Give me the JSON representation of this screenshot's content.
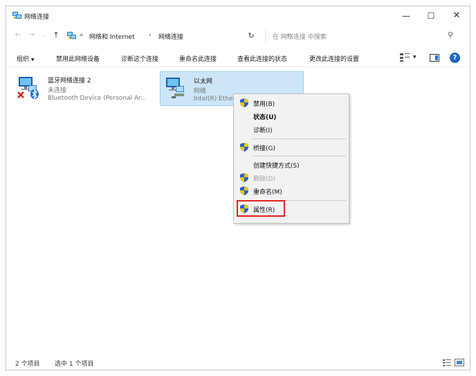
{
  "window": {
    "title": "网络连接",
    "controls": {
      "minimize": "—",
      "maximize": "☐",
      "close": "✕"
    }
  },
  "address_bar": {
    "prefix": "«",
    "crumbs": [
      "网络和 Internet",
      "网络连接"
    ],
    "separator": "›",
    "dropdown": "⌄",
    "refresh": "↻"
  },
  "search": {
    "placeholder": "在 网络连接 中搜索",
    "icon": "⚲"
  },
  "commands": {
    "organize": "组织",
    "organize_caret": "▼",
    "items": [
      "禁用此网络设备",
      "诊断这个连接",
      "重命名此连接",
      "查看此连接的状态",
      "更改此连接的设置"
    ],
    "help": "?"
  },
  "connections": [
    {
      "name": "蓝牙网络连接 2",
      "status": "未连接",
      "device": "Bluetooth Device (Personal Ar..."
    },
    {
      "name": "以太网",
      "status": "网络",
      "device": "Intel(R) Ethe"
    }
  ],
  "context_menu": {
    "items": [
      {
        "label": "禁用(B)",
        "shield": true,
        "style": "normal"
      },
      {
        "label": "状态(U)",
        "shield": false,
        "style": "bold"
      },
      {
        "label": "诊断(I)",
        "shield": false,
        "style": "normal"
      },
      {
        "label": "桥接(G)",
        "shield": true,
        "style": "normal"
      },
      {
        "label": "创建快捷方式(S)",
        "shield": false,
        "style": "normal"
      },
      {
        "label": "删除(D)",
        "shield": true,
        "style": "disabled"
      },
      {
        "label": "重命名(M)",
        "shield": true,
        "style": "normal"
      },
      {
        "label": "属性(R)",
        "shield": true,
        "style": "normal",
        "highlighted": true
      }
    ]
  },
  "status_bar": {
    "count": "2 个项目",
    "selected": "选中 1 个项目"
  },
  "colors": {
    "selection_bg": "#cce6f8",
    "selection_border": "#9ccdf2",
    "highlight_box": "#e0221f",
    "help_blue": "#1a66c9",
    "error_red": "#e0221f",
    "bluetooth_blue": "#1c6fd0"
  },
  "icons": {
    "app": "network-connections-icon",
    "ethernet": "network-adapter-icon",
    "bluetooth": "bluetooth-icon",
    "disconnected": "red-x-icon",
    "uac": "uac-shield-icon"
  }
}
